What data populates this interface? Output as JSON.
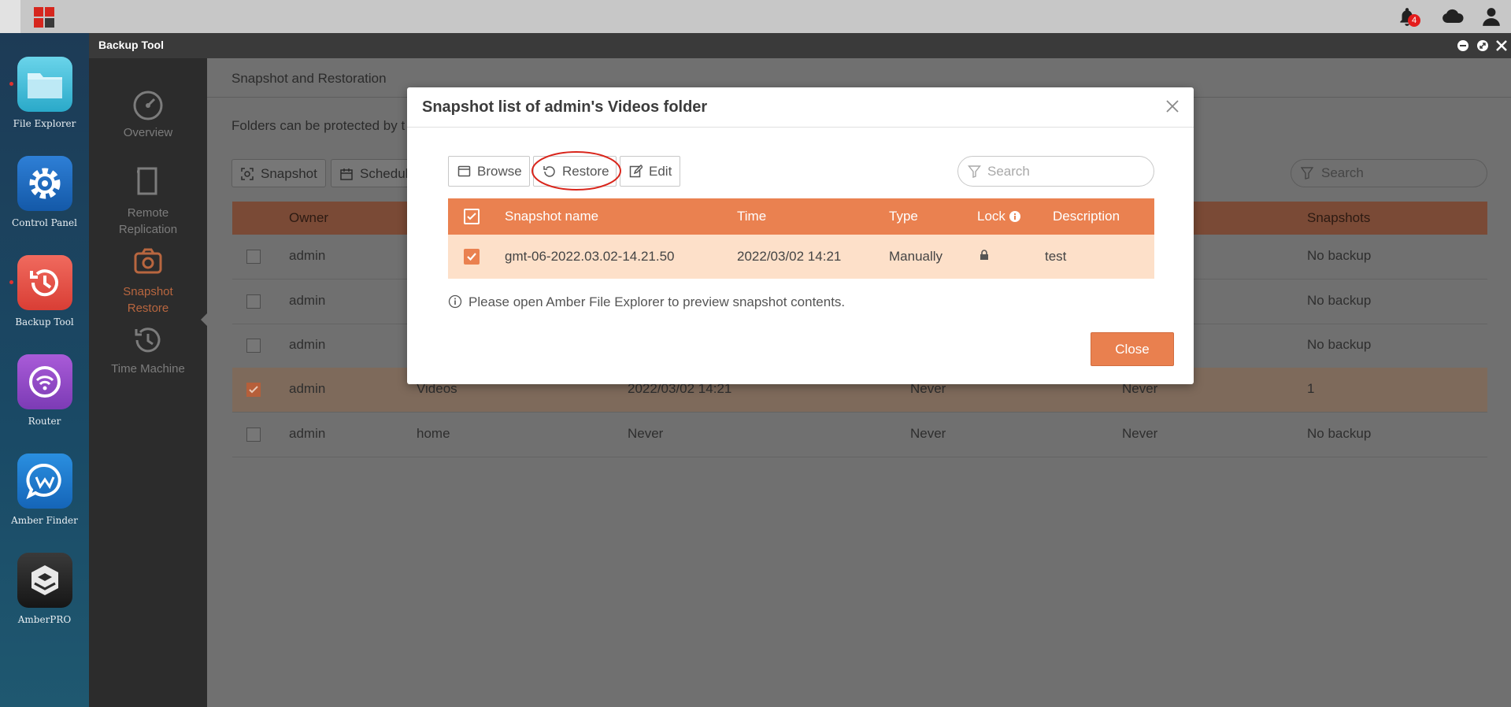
{
  "topbar": {
    "logo": "app-grid-logo",
    "icons": [
      "bell-icon",
      "cloud-icon",
      "user-icon"
    ],
    "notification_count": "4",
    "colors": {
      "logo_red": "#d6271e",
      "badge": "#e41c1c"
    }
  },
  "dock": {
    "items": [
      {
        "label": "File Explorer",
        "icon": "folder-icon"
      },
      {
        "label": "Control Panel",
        "icon": "gear-icon"
      },
      {
        "label": "Backup Tool",
        "icon": "clock-restore-icon"
      },
      {
        "label": "Router",
        "icon": "wifi-icon"
      },
      {
        "label": "Amber Finder",
        "icon": "chat-w-icon"
      },
      {
        "label": "AmberPRO",
        "icon": "cube-icon"
      }
    ]
  },
  "window": {
    "title": "Backup Tool",
    "controls": [
      "minimize-icon",
      "restore-icon",
      "close-icon"
    ],
    "sidebar": [
      {
        "label": "Overview",
        "icon": "gauge-icon"
      },
      {
        "label": "Remote Replication",
        "icon": "copy-icon"
      },
      {
        "label": "Snapshot Restore",
        "icon": "camera-icon",
        "active": true
      },
      {
        "label": "Time Machine",
        "icon": "history-icon"
      }
    ],
    "content": {
      "breadcrumb": "Snapshot and Restoration",
      "description": "Folders can be protected by t",
      "snapshot_button": "Snapshot",
      "schedule_button": "Schedule",
      "search_placeholder": "Search",
      "columns": {
        "owner": "Owner",
        "snapshots": "Snapshots"
      },
      "rows": [
        {
          "owner": "admin",
          "folder": "",
          "last": "",
          "schedule": "",
          "next": "",
          "snapshots": "No backup",
          "selected": false
        },
        {
          "owner": "admin",
          "folder": "",
          "last": "",
          "schedule": "",
          "next": "",
          "snapshots": "No backup",
          "selected": false
        },
        {
          "owner": "admin",
          "folder": "",
          "last": "",
          "schedule": "",
          "next": "",
          "snapshots": "No backup",
          "selected": false
        },
        {
          "owner": "admin",
          "folder": "Videos",
          "last": "2022/03/02 14:21",
          "schedule": "Never",
          "next": "Never",
          "snapshots": "1",
          "selected": true
        },
        {
          "owner": "admin",
          "folder": "home",
          "last": "Never",
          "schedule": "Never",
          "next": "Never",
          "snapshots": "No backup",
          "selected": false
        }
      ]
    }
  },
  "modal": {
    "title": "Snapshot list of admin's Videos folder",
    "toolbar": {
      "browse": "Browse",
      "restore": "Restore",
      "edit": "Edit"
    },
    "search_placeholder": "Search",
    "columns": {
      "name": "Snapshot name",
      "time": "Time",
      "type": "Type",
      "lock": "Lock",
      "description": "Description"
    },
    "row": {
      "name": "gmt-06-2022.03.02-14.21.50",
      "time": "2022/03/02 14:21",
      "type": "Manually",
      "locked": true,
      "description": "test"
    },
    "info": "Please open Amber File Explorer to preview snapshot contents.",
    "close_button": "Close",
    "colors": {
      "accent": "#ea8150",
      "row_highlight": "#fde0c9",
      "annotation": "#d9261c"
    }
  }
}
